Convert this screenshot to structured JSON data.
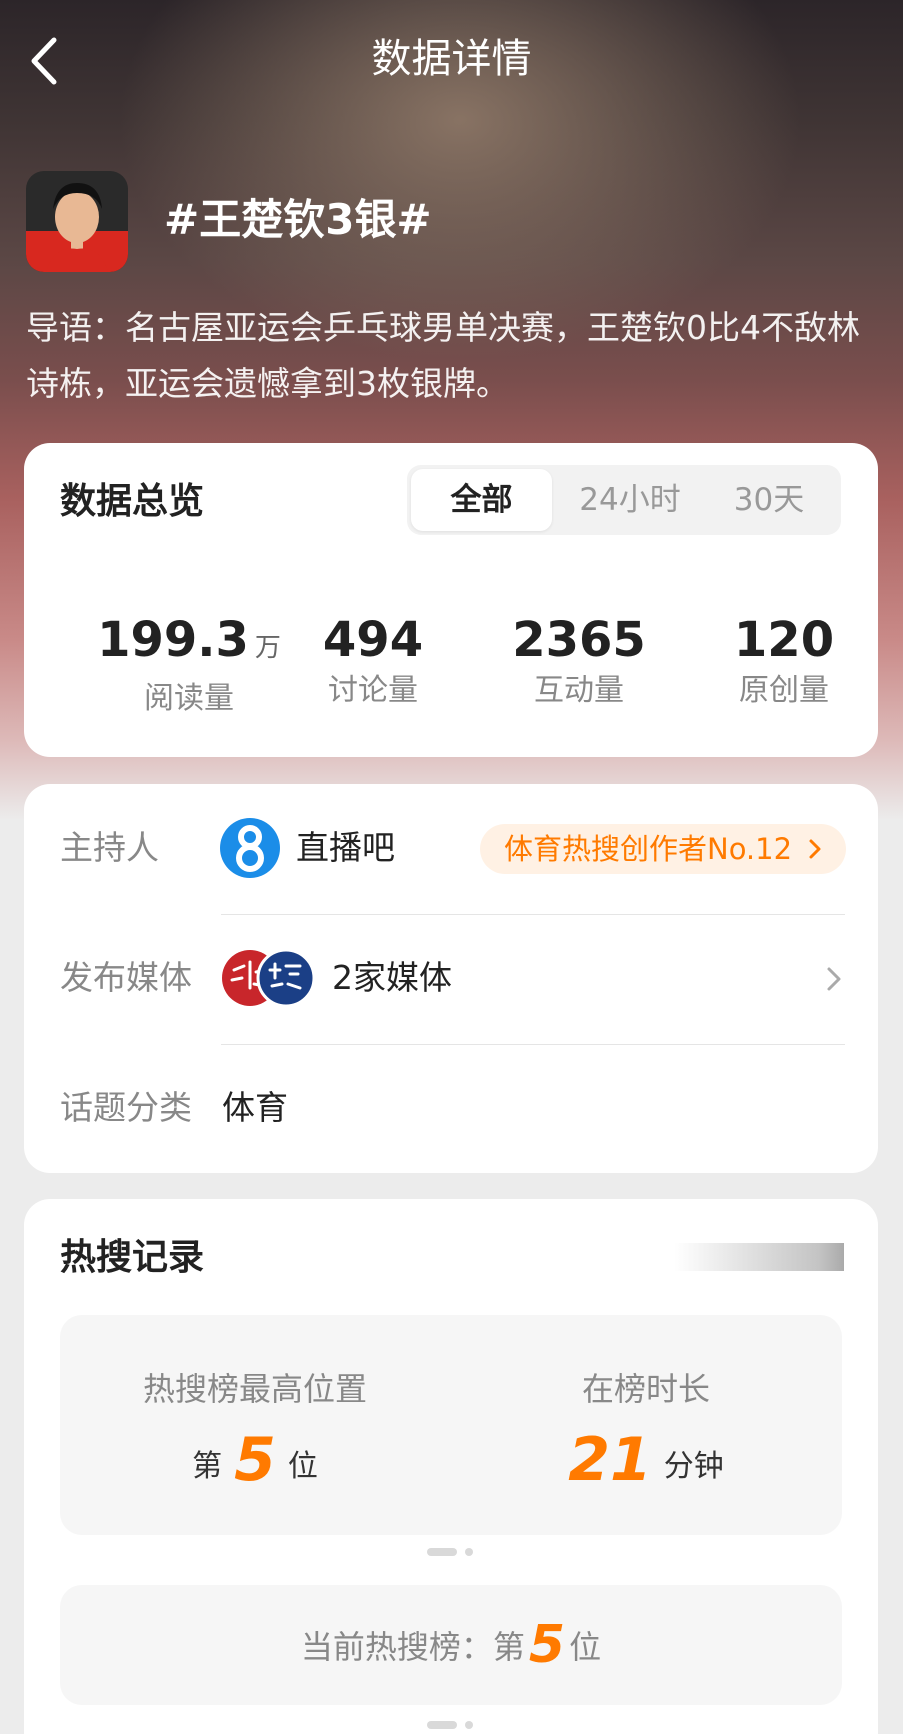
{
  "header": {
    "title": "数据详情"
  },
  "topic": {
    "title": "#王楚钦3银#",
    "intro": "导语：名古屋亚运会乒乓球男单决赛，王楚钦0比4不敌林诗栋，亚运会遗憾拿到3枚银牌。"
  },
  "overview": {
    "title": "数据总览",
    "tabs": [
      "全部",
      "24小时",
      "30天"
    ],
    "active_tab": "全部",
    "stats": [
      {
        "value": "199.3",
        "unit": "万",
        "label": "阅读量"
      },
      {
        "value": "494",
        "unit": "",
        "label": "讨论量"
      },
      {
        "value": "2365",
        "unit": "",
        "label": "互动量"
      },
      {
        "value": "120",
        "unit": "",
        "label": "原创量"
      }
    ]
  },
  "info": {
    "host_label": "主持人",
    "host_name": "直播吧",
    "host_badge": "体育热搜创作者No.12",
    "media_label": "发布媒体",
    "media_value": "2家媒体",
    "category_label": "话题分类",
    "category_value": "体育"
  },
  "records": {
    "title": "热搜记录",
    "highest_label": "热搜榜最高位置",
    "highest_prefix": "第",
    "highest_value": "5",
    "highest_suffix": "位",
    "duration_label": "在榜时长",
    "duration_value": "21",
    "duration_unit": "分钟",
    "current_label": "当前热搜榜：第",
    "current_value": "5",
    "current_suffix": "位"
  },
  "colors": {
    "accent": "#ff7a00",
    "badge_bg": "#fff1e4"
  }
}
